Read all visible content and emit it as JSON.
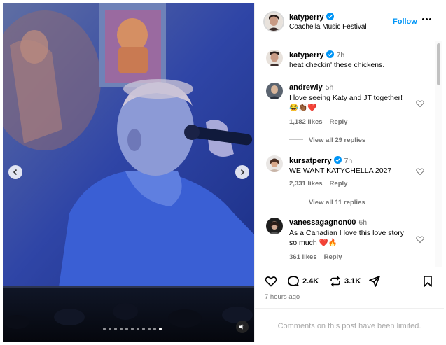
{
  "post": {
    "username": "katyperry",
    "location": "Coachella Music Festival",
    "follow_label": "Follow",
    "caption": {
      "username": "katyperry",
      "time": "7h",
      "text": "heat checkin' these chickens."
    }
  },
  "media": {
    "carousel_count": 11,
    "active_index": 10,
    "icons": {
      "prev": "chevron-left-icon",
      "next": "chevron-right-icon",
      "audio": "speaker-icon"
    }
  },
  "comments": [
    {
      "username": "andrewly",
      "time": "5h",
      "text": "I love seeing Katy and JT together! 😂👏🏾❤️",
      "likes": "1,182 likes",
      "reply_label": "Reply",
      "replies": "View all 29 replies"
    },
    {
      "username": "kursatperry",
      "time": "7h",
      "text": "WE WANT KATYCHELLA 2027",
      "likes": "2,331 likes",
      "reply_label": "Reply",
      "replies": "View all 11 replies"
    },
    {
      "username": "vanessagagnon00",
      "time": "6h",
      "text": "As a Canadian I love this love story so much ❤️🔥",
      "likes": "361 likes",
      "reply_label": "Reply"
    }
  ],
  "actions": {
    "comment_count": "2.4K",
    "repost_count": "3.1K",
    "posted_time": "7 hours ago"
  },
  "footer": {
    "limited_text": "Comments on this post have been limited."
  },
  "colors": {
    "accent": "#0095f6",
    "verified": "#0095f6",
    "secondary_text": "#737373",
    "heart_red": "#e0245e"
  }
}
